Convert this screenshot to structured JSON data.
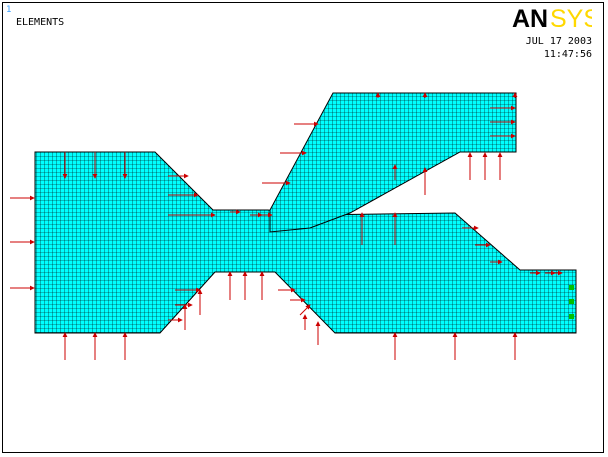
{
  "window": {
    "number": "1",
    "plot_label": "ELEMENTS",
    "date": "JUL 17 2003",
    "time": "11:47:56"
  },
  "logo": {
    "text_black": "AN",
    "text_yellow": "SYS",
    "color_black": "#000000",
    "color_yellow": "#ffd800"
  },
  "colors": {
    "mesh_fill": "#00ffff",
    "mesh_line": "#000000",
    "load_arrow": "#cc0000",
    "constraint": "#00c000",
    "background": "#ffffff"
  },
  "icons": {
    "load_arrow": "force-arrow-icon",
    "constraint": "constraint-symbol-icon"
  }
}
